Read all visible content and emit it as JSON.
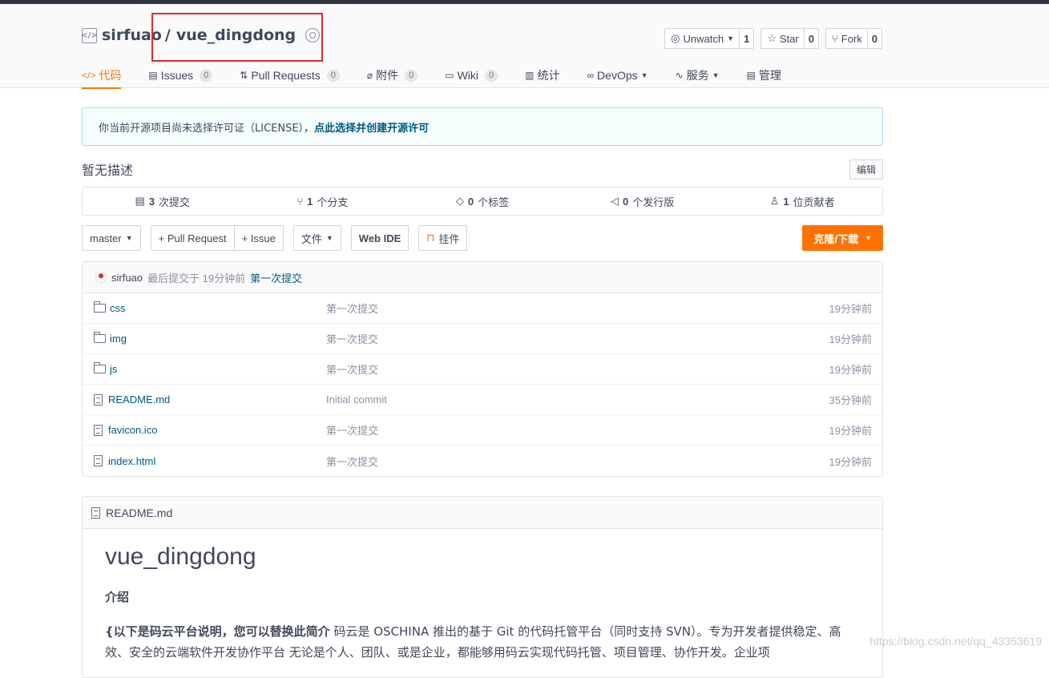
{
  "repo": {
    "owner": "sirfuao",
    "separator": "/",
    "name": "vue_dingdong"
  },
  "actions": [
    {
      "label": "Unwatch",
      "count": "1",
      "icon": "eye-icon",
      "caret": true
    },
    {
      "label": "Star",
      "count": "0",
      "icon": "star-icon",
      "caret": false
    },
    {
      "label": "Fork",
      "count": "0",
      "icon": "fork-icon",
      "caret": false
    }
  ],
  "tabs": [
    {
      "label": "代码",
      "icon": "code-icon",
      "active": true
    },
    {
      "label": "Issues",
      "count": "0",
      "icon": "issues-icon"
    },
    {
      "label": "Pull Requests",
      "count": "0",
      "icon": "pull-request-icon"
    },
    {
      "label": "附件",
      "count": "0",
      "icon": "attachment-icon"
    },
    {
      "label": "Wiki",
      "count": "0",
      "icon": "wiki-icon"
    },
    {
      "label": "统计",
      "icon": "stats-icon"
    },
    {
      "label": "DevOps",
      "icon": "devops-icon",
      "caret": true
    },
    {
      "label": "服务",
      "icon": "service-icon",
      "caret": true
    },
    {
      "label": "管理",
      "icon": "manage-icon"
    }
  ],
  "notice": {
    "text": "你当前开源项目尚未选择许可证（LICENSE），",
    "link": "点此选择并创建开源许可"
  },
  "description": {
    "text": "暂无描述",
    "edit": "编辑"
  },
  "stats": [
    {
      "num": "3",
      "label": "次提交",
      "icon": "commit-icon"
    },
    {
      "num": "1",
      "label": "个分支",
      "icon": "branch-icon"
    },
    {
      "num": "0",
      "label": "个标签",
      "icon": "tag-icon"
    },
    {
      "num": "0",
      "label": "个发行版",
      "icon": "release-icon"
    },
    {
      "num": "1",
      "label": "位贡献者",
      "icon": "contributor-icon"
    }
  ],
  "toolbar": {
    "branch": "master",
    "pull_request": "+ Pull Request",
    "issue": "+ Issue",
    "file": "文件",
    "webide": "Web IDE",
    "pin": "挂件",
    "clone": "克隆/下载"
  },
  "last_commit": {
    "author": "sirfuao",
    "meta": "最后提交于 19分钟前",
    "message": "第一次提交"
  },
  "files": [
    {
      "name": "css",
      "type": "folder",
      "message": "第一次提交",
      "time": "19分钟前"
    },
    {
      "name": "img",
      "type": "folder",
      "message": "第一次提交",
      "time": "19分钟前"
    },
    {
      "name": "js",
      "type": "folder",
      "message": "第一次提交",
      "time": "19分钟前"
    },
    {
      "name": "README.md",
      "type": "file",
      "message": "Initial commit",
      "time": "35分钟前"
    },
    {
      "name": "favicon.ico",
      "type": "file",
      "message": "第一次提交",
      "time": "19分钟前"
    },
    {
      "name": "index.html",
      "type": "file",
      "message": "第一次提交",
      "time": "19分钟前"
    }
  ],
  "readme": {
    "filename": "README.md",
    "title": "vue_dingdong",
    "section": "介绍",
    "body_bold": "{以下是码云平台说明，您可以替换此简介",
    "body": " 码云是 OSCHINA 推出的基于 Git 的代码托管平台（同时支持 SVN）。专为开发者提供稳定、高效、安全的云端软件开发协作平台 无论是个人、团队、或是企业，都能够用码云实现代码托管、项目管理、协作开发。企业项"
  },
  "watermark": "https://blog.csdn.net/qq_43353619"
}
